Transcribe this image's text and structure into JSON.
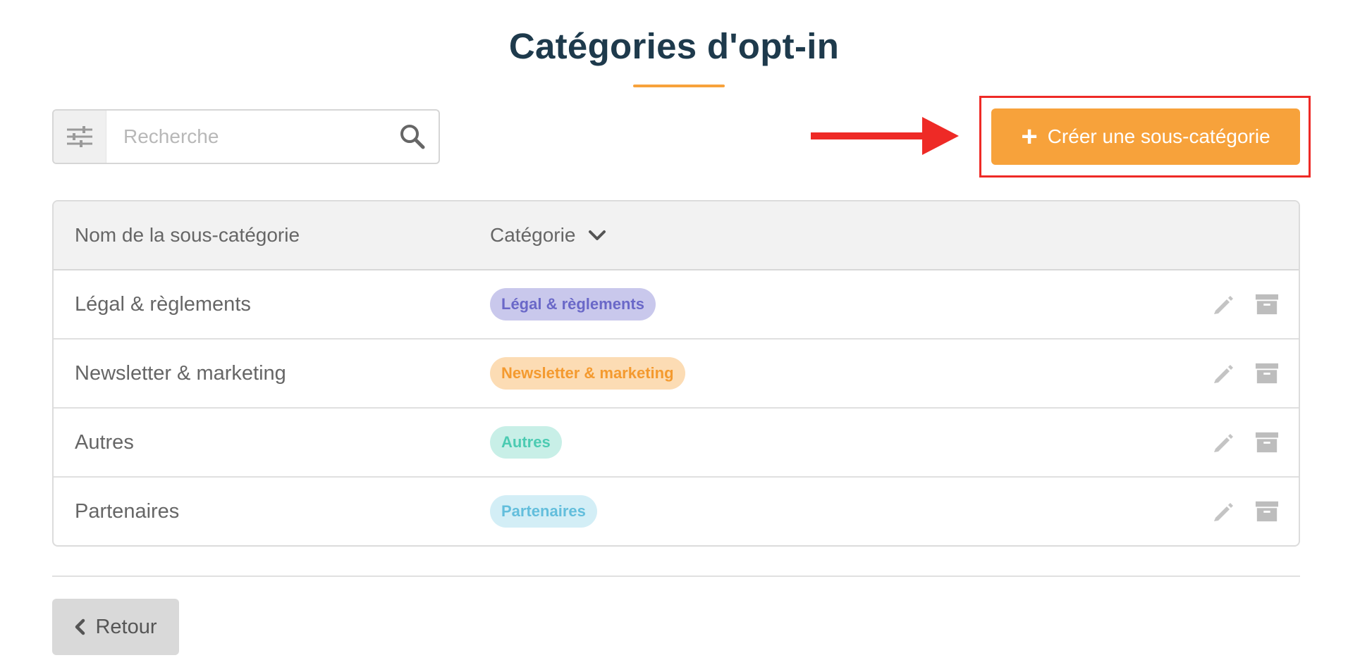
{
  "page": {
    "title": "Catégories d'opt-in"
  },
  "search": {
    "placeholder": "Recherche",
    "value": ""
  },
  "actions": {
    "create_label": "Créer une sous-catégorie"
  },
  "table": {
    "headers": {
      "name": "Nom de la sous-catégorie",
      "category": "Catégorie"
    },
    "rows": [
      {
        "name": "Légal & règlements",
        "category": "Légal & règlements",
        "badge_bg": "#c9c8ec",
        "badge_fg": "#6a68c8"
      },
      {
        "name": "Newsletter & marketing",
        "category": "Newsletter & marketing",
        "badge_bg": "#fcdcb4",
        "badge_fg": "#f49a2f"
      },
      {
        "name": "Autres",
        "category": "Autres",
        "badge_bg": "#c8efe7",
        "badge_fg": "#4ccbb2"
      },
      {
        "name": "Partenaires",
        "category": "Partenaires",
        "badge_bg": "#d3eef6",
        "badge_fg": "#63bedc"
      }
    ]
  },
  "footer": {
    "back_label": "Retour"
  },
  "colors": {
    "accent": "#f7a23b",
    "title": "#1e3a4c",
    "annotation": "#ee2a26"
  },
  "icons": [
    "filter-sliders-icon",
    "search-icon",
    "plus-icon",
    "chevron-down-icon",
    "pencil-icon",
    "archive-icon",
    "chevron-left-icon"
  ]
}
